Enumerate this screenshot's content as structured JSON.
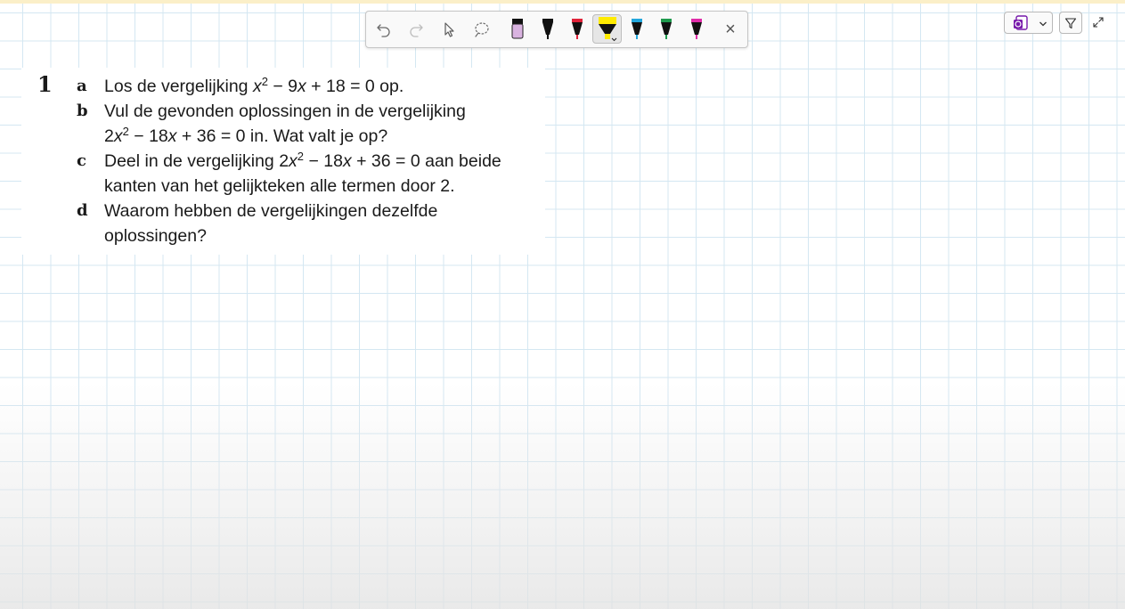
{
  "exercise": {
    "number": "1",
    "parts": [
      {
        "letter": "a",
        "lines": [
          {
            "pre": "Los de vergelijking ",
            "math1": "x",
            "sup": "2",
            "math2": " − 9",
            "var2": "x",
            "post": " + 18 = 0 op."
          }
        ]
      },
      {
        "letter": "b",
        "line1": "Vul de gevonden oplossingen in de vergelijking",
        "line2": {
          "pre": "2",
          "var1": "x",
          "sup": "2",
          "mid": " − 18",
          "var2": "x",
          "post": " + 36 = 0 in. Wat valt je op?"
        }
      },
      {
        "letter": "c",
        "line1": {
          "pre": "Deel in de vergelijking 2",
          "var1": "x",
          "sup": "2",
          "mid": " − 18",
          "var2": "x",
          "post": " + 36 = 0 aan beide"
        },
        "line2": "kanten van het gelijkteken alle termen door 2."
      },
      {
        "letter": "d",
        "line1": "Waarom hebben de vergelijkingen dezelfde",
        "line2": "oplossingen?"
      }
    ]
  },
  "toolbar": {
    "tools": [
      "undo-icon",
      "redo-icon",
      "select-icon",
      "lasso-icon"
    ],
    "pens": [
      {
        "name": "eraser",
        "color": "#d9b3e0"
      },
      {
        "name": "black",
        "color": "#111111"
      },
      {
        "name": "red",
        "color": "#e0233a"
      },
      {
        "name": "yellow-highlighter",
        "color": "#ffeb00",
        "selected": true
      },
      {
        "name": "blue",
        "color": "#22a6dc"
      },
      {
        "name": "green",
        "color": "#1f9a4e"
      },
      {
        "name": "magenta",
        "color": "#e02ca8"
      }
    ],
    "close": "×"
  },
  "controls": {
    "app_icon": "onenote-icon",
    "dropdown": "chevron-down-icon",
    "filter": "filter-icon",
    "expand": "expand-icon"
  },
  "colors": {
    "grid": "#d4e7f2",
    "top_strip": "#fbefc8",
    "app_purple": "#7719aa"
  }
}
